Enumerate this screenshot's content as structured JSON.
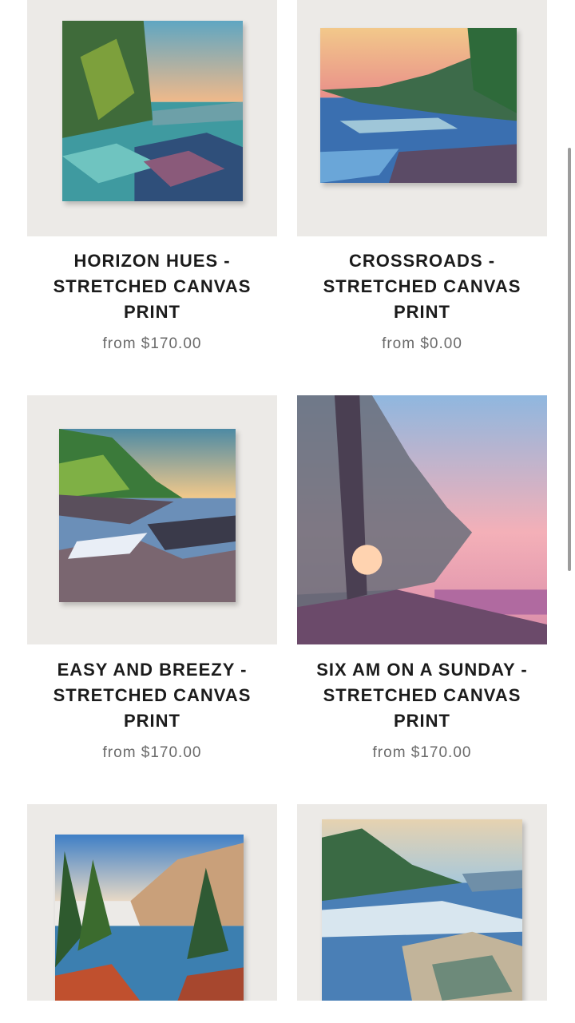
{
  "products": [
    {
      "title_line1": "HORIZON HUES -",
      "title_line2": "STRETCHED CANVAS",
      "title_line3": "PRINT",
      "price": "from $170.00",
      "image_icon": "landscape-painting"
    },
    {
      "title_line1": "CROSSROADS -",
      "title_line2": "STRETCHED CANVAS",
      "title_line3": "PRINT",
      "price": "from $0.00",
      "image_icon": "landscape-painting"
    },
    {
      "title_line1": "EASY AND BREEZY -",
      "title_line2": "STRETCHED CANVAS",
      "title_line3": "PRINT",
      "price": "from $170.00",
      "image_icon": "landscape-painting"
    },
    {
      "title_line1": "SIX AM ON A SUNDAY -",
      "title_line2": "STRETCHED CANVAS",
      "title_line3": "PRINT",
      "price": "from $170.00",
      "image_icon": "landscape-painting"
    },
    {
      "image_icon": "landscape-painting"
    },
    {
      "image_icon": "landscape-painting"
    }
  ],
  "colors": {
    "background": "#ffffff",
    "title": "#1b1b1b",
    "price": "#6a6a6a",
    "frame": "#eceae7"
  }
}
